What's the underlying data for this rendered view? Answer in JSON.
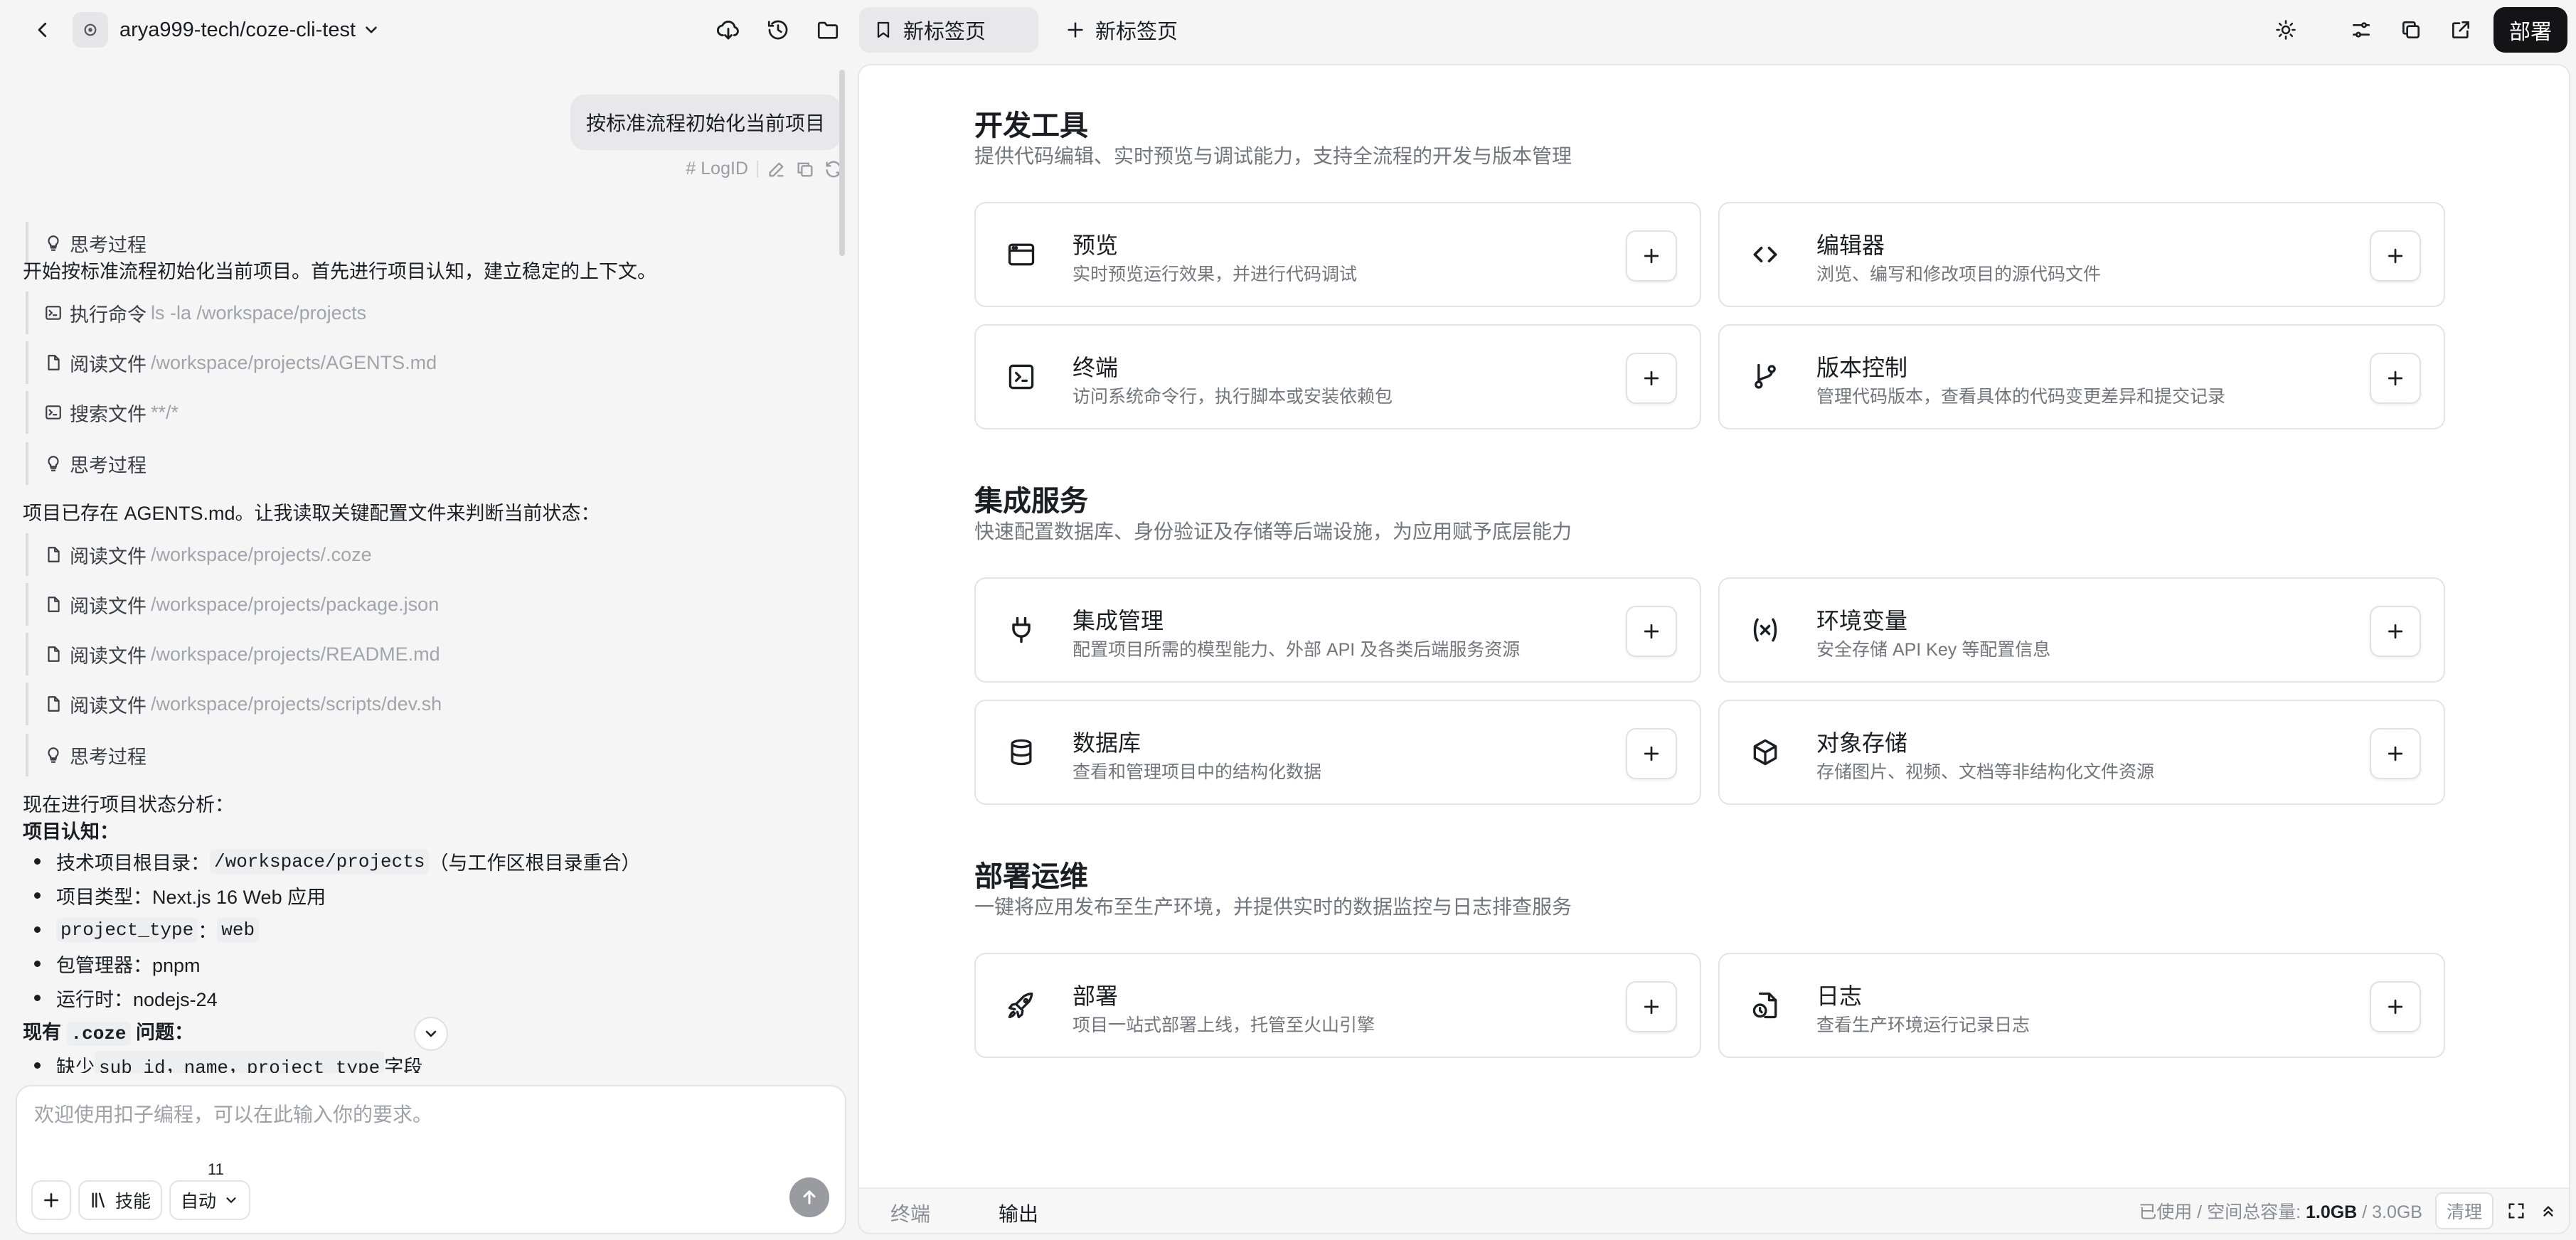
{
  "topbar": {
    "repo_name": "arya999-tech/coze-cli-test",
    "tabs": [
      {
        "label": "新标签页"
      },
      {
        "label": "新标签页"
      }
    ],
    "deploy_label": "部署"
  },
  "chat": {
    "user_message": "按标准流程初始化当前项目",
    "log_id_label": "LogID",
    "thinking_label": "思考过程",
    "intro_text": "开始按标准流程初始化当前项目。首先进行项目认知，建立稳定的上下文。",
    "steps_a": [
      {
        "action": "执行命令",
        "arg": "ls -la /workspace/projects"
      },
      {
        "action": "阅读文件",
        "arg": "/workspace/projects/AGENTS.md"
      },
      {
        "action": "搜索文件",
        "arg": "**/*"
      }
    ],
    "middle_text": "项目已存在 AGENTS.md。让我读取关键配置文件来判断当前状态：",
    "steps_b": [
      {
        "action": "阅读文件",
        "arg": "/workspace/projects/.coze"
      },
      {
        "action": "阅读文件",
        "arg": "/workspace/projects/package.json"
      },
      {
        "action": "阅读文件",
        "arg": "/workspace/projects/README.md"
      },
      {
        "action": "阅读文件",
        "arg": "/workspace/projects/scripts/dev.sh"
      }
    ],
    "analysis_text": "现在进行项目状态分析：",
    "cognition_heading": "项目认知：",
    "bullets": {
      "root_label": "技术项目根目录：",
      "root_code": "/workspace/projects",
      "root_note": "（与工作区根目录重合）",
      "type": "项目类型：Next.js 16 Web 应用",
      "ptype_code": "project_type",
      "ptype_sep": "：",
      "ptype_val": "web",
      "pkg": "包管理器：pnpm",
      "runtime": "运行时：nodejs-24"
    },
    "issue_prefix": "现有",
    "issue_code": ".coze",
    "issue_suffix": "问题：",
    "missing_prefix": "缺少",
    "missing_code": "sub_id，name，project_type",
    "missing_suffix": "字段",
    "composer_placeholder": "欢迎使用扣子编程，可以在此输入你的要求。",
    "skills_label": "技能",
    "skills_count": "11",
    "mode_label": "自动"
  },
  "panel": {
    "sections": [
      {
        "title": "开发工具",
        "subtitle": "提供代码编辑、实时预览与调试能力，支持全流程的开发与版本管理",
        "cards": [
          {
            "title": "预览",
            "desc": "实时预览运行效果，并进行代码调试",
            "icon": "browser-window-icon"
          },
          {
            "title": "编辑器",
            "desc": "浏览、编写和修改项目的源代码文件",
            "icon": "code-brackets-icon"
          },
          {
            "title": "终端",
            "desc": "访问系统命令行，执行脚本或安装依赖包",
            "icon": "terminal-icon"
          },
          {
            "title": "版本控制",
            "desc": "管理代码版本，查看具体的代码变更差异和提交记录",
            "icon": "git-branch-icon"
          }
        ]
      },
      {
        "title": "集成服务",
        "subtitle": "快速配置数据库、身份验证及存储等后端设施，为应用赋予底层能力",
        "cards": [
          {
            "title": "集成管理",
            "desc": "配置项目所需的模型能力、外部 API 及各类后端服务资源",
            "icon": "plug-icon"
          },
          {
            "title": "环境变量",
            "desc": "安全存储 API Key 等配置信息",
            "icon": "variable-icon"
          },
          {
            "title": "数据库",
            "desc": "查看和管理项目中的结构化数据",
            "icon": "database-icon"
          },
          {
            "title": "对象存储",
            "desc": "存储图片、视频、文档等非结构化文件资源",
            "icon": "box-icon"
          }
        ]
      },
      {
        "title": "部署运维",
        "subtitle": "一键将应用发布至生产环境，并提供实时的数据监控与日志排查服务",
        "cards": [
          {
            "title": "部署",
            "desc": "项目一站式部署上线，托管至火山引擎",
            "icon": "rocket-icon"
          },
          {
            "title": "日志",
            "desc": "查看生产环境运行记录日志",
            "icon": "log-file-icon"
          }
        ]
      }
    ],
    "footer": {
      "tabs": [
        "终端",
        "输出"
      ],
      "storage_label": "已使用 / 空间总容量:",
      "storage_used": "1.0GB",
      "storage_sep": "/",
      "storage_total": "3.0GB",
      "clean_label": "清理"
    }
  }
}
